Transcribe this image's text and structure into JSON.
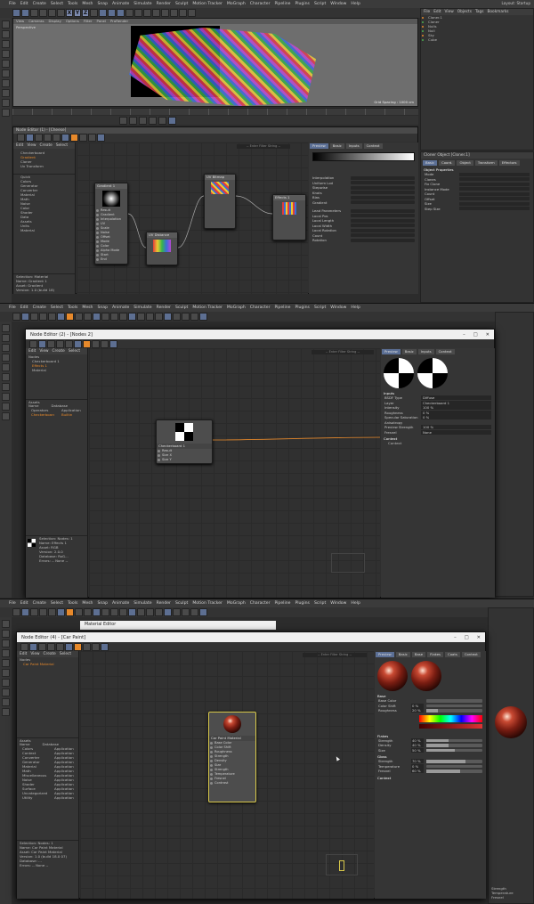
{
  "colors": {
    "accent_orange": "#e7892b",
    "node_select": "#d8c84a",
    "viewport_bg": "#6e6e6e",
    "node_bg": "#4d4d4d"
  },
  "section1": {
    "menu": [
      "File",
      "Edit",
      "Create",
      "Select",
      "Tools",
      "Mesh",
      "Snap",
      "Animate",
      "Simulate",
      "Render",
      "Sculpt",
      "Motion Tracker",
      "MoGraph",
      "Character",
      "Pipeline",
      "Plugins",
      "Script",
      "Window",
      "Help"
    ],
    "layout_label": "Layout:",
    "layout_value": "Startup",
    "viewport_menu": [
      "View",
      "Cameras",
      "Display",
      "Options",
      "Filter",
      "Panel",
      "ProRender"
    ],
    "viewport_label": "Perspective",
    "grid_spacing": "Grid Spacing : 1000 cm",
    "om_menu": [
      "File",
      "Edit",
      "View",
      "Objects",
      "Tags",
      "Bookmarks"
    ],
    "objects": [
      "Cloner.1",
      "Cloner",
      "Nulls",
      "Null",
      "Sky",
      "Cube"
    ],
    "node_editor_title": "Node Editor (1) - [Cheese]",
    "ne_menu": [
      "Edit",
      "View",
      "Create",
      "Select"
    ],
    "filter_placeholder": "-- Enter Filter String --",
    "attr_tabs": [
      "Preview",
      "Basic",
      "Inputs",
      "Context"
    ],
    "assets_tree": [
      "Checkerboard",
      "Gradient",
      "Cloner",
      "Uv Transform"
    ],
    "asset_list": [
      "Quick",
      "Colors",
      "Generator",
      "Converter",
      "Material",
      "Math",
      "Noise",
      "Color",
      "Shader",
      "Data",
      "Assets",
      "Units",
      "Material"
    ],
    "info_lines": [
      "Selection:  Material",
      "Name:  Gradient 1",
      "Asset:  Gradient",
      "Version:  1.0 (build 18)"
    ],
    "nodes": {
      "gradient": "Gradient 1",
      "uvmixer": "UV Distance",
      "bitmap": "UV Bitmap",
      "effects": "Effects 1"
    },
    "gradient_ports": [
      "Result",
      "Gradient",
      "Interpolation",
      "UV",
      "Scale",
      "Noise",
      "Offset",
      "Mode",
      "Color",
      "Alpha Mode",
      "Start",
      "End"
    ],
    "attr_rows": [
      "Interpolation",
      "Uniform Lod",
      "Stepwise",
      "Knots",
      "Bias",
      "Gradient"
    ],
    "properties_rows": [
      "Lead Parameters",
      "Local Pos",
      "Local Length",
      "Local Width",
      "Local Rotation",
      "Count",
      "Rotation"
    ],
    "am_title": "Cloner Object [Cloner.1]",
    "am_tabs": [
      "Basic",
      "Coord.",
      "Object",
      "Transform",
      "Effectors"
    ],
    "am_section": "Object Properties",
    "am_rows": [
      "Mode",
      "Clones",
      "Fix Clone",
      "Instance Mode",
      "Count",
      "Offset",
      "Size",
      "Step Size"
    ]
  },
  "section2": {
    "menu": [
      "File",
      "Edit",
      "Create",
      "Select",
      "Tools",
      "Mesh",
      "Snap",
      "Animate",
      "Simulate",
      "Render",
      "Sculpt",
      "Motion Tracker",
      "MoGraph",
      "Character",
      "Pipeline",
      "Plugins",
      "Script",
      "Window",
      "Help"
    ],
    "window_title": "Node Editor (2) - [Nodes 2]",
    "ne_menu": [
      "Edit",
      "View",
      "Create",
      "Select"
    ],
    "nodes_label": "Nodes",
    "tree_items": [
      "Checkerboard 1",
      "Effects 1",
      "Material"
    ],
    "filter_placeholder": "-- Enter Filter String --",
    "attr_tabs": [
      "Preview",
      "Basic",
      "Inputs",
      "Context"
    ],
    "node_title": "Checkerboard 1",
    "node_ports": [
      "Result",
      "Size X",
      "Size Y"
    ],
    "assets_label": "Assets",
    "assets_cols": [
      "Name",
      "Database"
    ],
    "assets_rows": [
      [
        "Operators",
        "Application"
      ],
      [
        "Checkerboard",
        "Builtin"
      ]
    ],
    "info_lines": [
      "Selection:  Nodes: 1",
      "Name:  Effects 1",
      "Asset:  RGB",
      "Version:  2.0.0",
      "Database:  RoG...",
      "Errors:  -- None --"
    ],
    "inputs_label": "Inputs",
    "input_rows": [
      [
        "BSDF Type",
        "Diffuse"
      ],
      [
        "Layer",
        "Checkerboard 1"
      ],
      [
        "Intensity",
        "100 %"
      ],
      [
        "Roughness",
        "0 %"
      ],
      [
        "Specular Saturation",
        "0 %"
      ],
      [
        "Anisotropy",
        ""
      ],
      [
        "Preview Strength",
        "100 %"
      ],
      [
        "Fresnel",
        "None"
      ]
    ],
    "context_label": "Context",
    "context_row": "Context"
  },
  "section3": {
    "menu": [
      "File",
      "Edit",
      "Create",
      "Select",
      "Tools",
      "Mesh",
      "Snap",
      "Animate",
      "Simulate",
      "Render",
      "Sculpt",
      "Motion Tracker",
      "MoGraph",
      "Character",
      "Pipeline",
      "Plugins",
      "Script",
      "Window",
      "Help"
    ],
    "back_window_title": "Material Editor",
    "window_title": "Node Editor (4) - [Car Paint]",
    "ne_menu": [
      "Edit",
      "View",
      "Create",
      "Select"
    ],
    "nodes_label": "Nodes",
    "tree_items": [
      "Car Paint Material"
    ],
    "filter_placeholder": "-- Enter Filter String --",
    "attr_tabs": [
      "Preview",
      "Basic",
      "Base",
      "Flakes",
      "Coats",
      "Context"
    ],
    "node_title": "Car Paint Material",
    "node_ports": [
      "Base Color",
      "Color Shift",
      "Roughness",
      "Strength",
      "Density",
      "Size",
      "Strength",
      "Temperature",
      "Fresnel",
      "Contrast"
    ],
    "assets_label": "Assets",
    "assets_cols": [
      "Name",
      "Database"
    ],
    "assets_rows": [
      [
        "Colors",
        "Application"
      ],
      [
        "Context",
        "Application"
      ],
      [
        "Converter",
        "Application"
      ],
      [
        "Generator",
        "Application"
      ],
      [
        "Material",
        "Application"
      ],
      [
        "Math",
        "Application"
      ],
      [
        "Miscellaneous",
        "Application"
      ],
      [
        "Noise",
        "Application"
      ],
      [
        "Shader",
        "Application"
      ],
      [
        "Surface",
        "Application"
      ],
      [
        "Uncategorized",
        "Application"
      ],
      [
        "Utility",
        "Application"
      ]
    ],
    "info_lines": [
      "Selection:  Nodes: 1",
      "Name:  Car Paint Material",
      "Asset:  Car Paint Material",
      "Version:  1.0 (build 18.0 07)",
      "Database:  ...",
      "Errors:  -- None --"
    ],
    "base_label": "Base",
    "base_rows": [
      [
        "Base Color",
        ""
      ],
      [
        "Color Shift",
        "0 %"
      ],
      [
        "Roughness",
        "20 %"
      ]
    ],
    "flakes_label": "Flakes",
    "flakes_rows": [
      [
        "Strength",
        "40 %"
      ],
      [
        "Density",
        "40 %"
      ],
      [
        "Size",
        "50 %"
      ]
    ],
    "gloss_label": "Gloss",
    "gloss_rows": [
      [
        "Strength",
        "70 %"
      ],
      [
        "Temperature",
        "0 %"
      ],
      [
        "Fresnel",
        "60 %"
      ]
    ],
    "context_label": "Context",
    "right_rows": [
      "Strength",
      "Temperature",
      "Fresnel"
    ]
  }
}
